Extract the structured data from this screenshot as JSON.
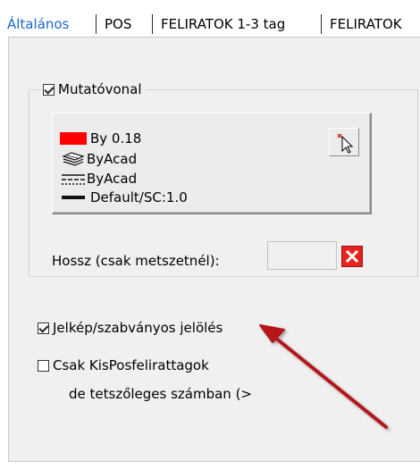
{
  "tabs": [
    {
      "label": "Általános",
      "active": true
    },
    {
      "label": "POS",
      "active": false
    },
    {
      "label": "FELIRATOK 1-3 tag",
      "active": false
    },
    {
      "label": "FELIRATOK",
      "active": false
    }
  ],
  "group": {
    "label": "Mutatóvonal",
    "checked": true,
    "properties": [
      {
        "icon": "red-color-swatch",
        "text": "By 0.18"
      },
      {
        "icon": "layers-icon",
        "text": "ByAcad"
      },
      {
        "icon": "linetype-icon",
        "text": "ByAcad"
      },
      {
        "icon": "lineweight-icon",
        "text": "Default/SC:1.0"
      }
    ],
    "pick_button_icon": "cursor-pick-icon"
  },
  "hossz": {
    "label": "Hossz (csak metszetnél):",
    "value": "",
    "clear_icon": "red-x-icon"
  },
  "options": [
    {
      "label": "Jelkép/szabványos jelölés",
      "checked": true
    },
    {
      "label_line1": "Csak KisPosfelirattagok",
      "label_line2": "de tetszőleges számban (>",
      "checked": false
    }
  ],
  "colors": {
    "accent_tab": "#1a66c9",
    "swatch": "#ff0000",
    "arrow": "#b5121b",
    "clear_button": "#e8231f"
  }
}
